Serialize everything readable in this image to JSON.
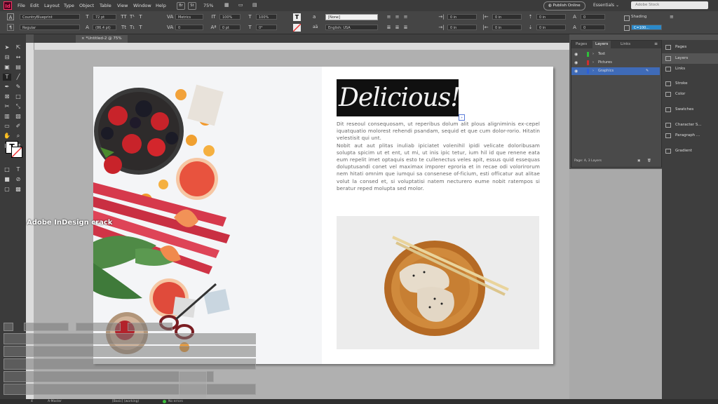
{
  "menubar": {
    "logo": "Id",
    "items": [
      "File",
      "Edit",
      "Layout",
      "Type",
      "Object",
      "Table",
      "View",
      "Window",
      "Help"
    ],
    "zoom": "75%",
    "publish_label": "Publish Online",
    "workspace_label": "Essentials",
    "search_placeholder": "Adobe Stock"
  },
  "control": {
    "font_family": "CountryBlueprint",
    "font_style": "Regular",
    "font_size": "72 pt",
    "leading": "(86.4 pt)",
    "kerning": "Metrics",
    "tracking": "0",
    "vscale": "100%",
    "hscale": "100%",
    "baseline": "0 pt",
    "skew": "0°",
    "char_style": "[None]",
    "language": "English: USA",
    "spacing": [
      "0 in",
      "0 in",
      "0 in",
      "0 in"
    ],
    "shading_label": "Shading",
    "swatch": "C=100..."
  },
  "document": {
    "tab_label": "*Untitled-2 @ 75%"
  },
  "page": {
    "headline": "Delicious!",
    "body_p1": "Dit reseoul consequosam, ut reperibus dolum alit plous aligniminis ex-cepel iquatquatio molorest rehendi psandam, sequid et que cum dolor-rorio. Hitatin velestisit qui unt.",
    "body_p2": "Nobit aut aut plitas inuliab ipiciatet volenihil ipidi velicate doloribusam solupta spicim ut et ent, ut mi, ut inis ipic tetur, ium hil id que renene eata eum repelit imet optaquis esto te cullenectus veles apit, essus quid essequas doluptusandi conet vel maximax imporer eproria et in recae odi volorirorum nem hitati omnim que iumqui sa consenese of-ficium, esti officatur aut alitae volut la consed et, si voluptatisi natem necturero eume nobit ratempos si beratur reped molupta sed molor."
  },
  "watermark": "Adobe InDesign crack",
  "layers_panel": {
    "tabs": [
      "Pages",
      "Layers",
      "Links"
    ],
    "layers": [
      {
        "name": "Text",
        "color": "#2fbf3a"
      },
      {
        "name": "Pictures",
        "color": "#d12e2e"
      },
      {
        "name": "Graphics",
        "color": "#2d5fd8"
      }
    ],
    "footer": "Page: A, 3 Layers"
  },
  "dock": {
    "items": [
      "Pages",
      "Layers",
      "Links",
      "Stroke",
      "Color",
      "Swatches",
      "Character S...",
      "Paragraph ...",
      "Gradient"
    ]
  },
  "statusbar": {
    "page": "4",
    "master": "A-Master",
    "style": "[Basic] (working)",
    "errors": "No errors"
  }
}
